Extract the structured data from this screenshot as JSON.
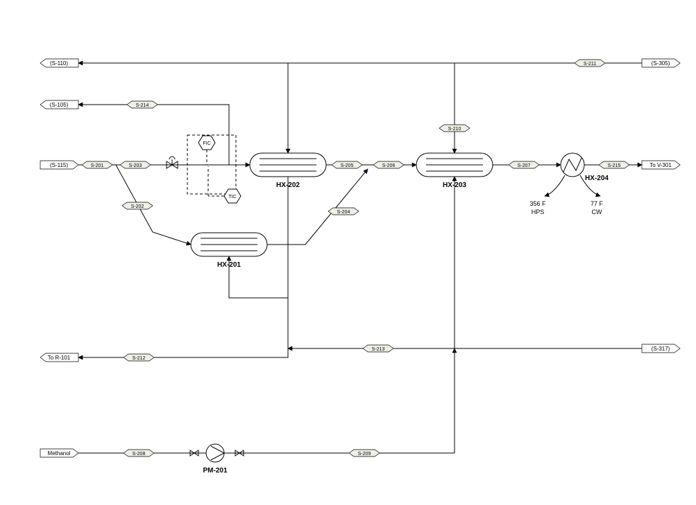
{
  "ports": {
    "s110": "(S-110)",
    "s105": "(S-105)",
    "s115": "(S-115)",
    "to_r101": "To R-101",
    "methanol": "Methanol",
    "s305": "(S-305)",
    "to_v301": "To V-301",
    "s317": "(S-317)"
  },
  "streams": {
    "s201": "S-201",
    "s202": "S-202",
    "s203": "S-203",
    "s204": "S-204",
    "s205": "S-205",
    "s206": "S-206",
    "s207": "S-207",
    "s208": "S-208",
    "s209": "S-209",
    "s210": "S-210",
    "s211": "S-211",
    "s212": "S-212",
    "s213": "S-213",
    "s214": "S-214",
    "s215": "S-215"
  },
  "equip": {
    "hx201": "HX-201",
    "hx202": "HX-202",
    "hx203": "HX-203",
    "hx204": "HX-204",
    "pm201": "PM-201"
  },
  "instruments": {
    "fic": "FIC",
    "tic": "TIC"
  },
  "conditions": {
    "hps_t": "356 F",
    "hps": "HPS",
    "cw_t": "77 F",
    "cw": "CW"
  }
}
